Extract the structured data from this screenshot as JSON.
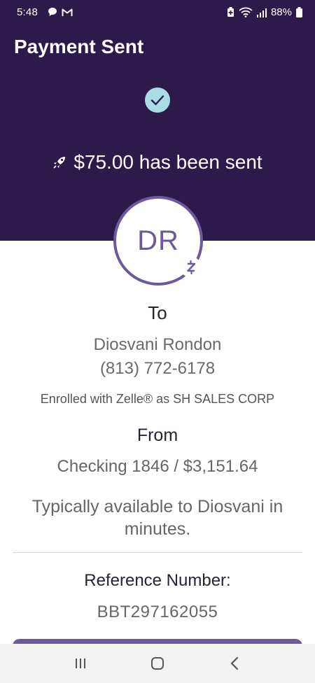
{
  "status_bar": {
    "time": "5:48",
    "battery": "88%"
  },
  "header": {
    "title": "Payment Sent",
    "amount_message": "$75.00 has been sent"
  },
  "recipient": {
    "initials": "DR",
    "to_label": "To",
    "name": "Diosvani Rondon",
    "phone": "(813) 772-6178",
    "enrollment": "Enrolled with Zelle® as SH SALES CORP"
  },
  "source": {
    "from_label": "From",
    "account": "Checking 1846 / $3,151.64"
  },
  "availability_note": "Typically available to Diosvani in minutes.",
  "reference": {
    "label": "Reference Number:",
    "number": "BBT297162055"
  },
  "colors": {
    "header_bg": "#2c1a4a",
    "accent": "#6e5a9b",
    "check_bg": "#a8dde6"
  },
  "icons": [
    "chat-icon",
    "gmail-icon",
    "battery-saver-icon",
    "wifi-icon",
    "signal-icon",
    "battery-icon",
    "check-icon",
    "rocket-icon",
    "zelle-icon",
    "recent-apps-icon",
    "home-icon",
    "back-icon"
  ]
}
